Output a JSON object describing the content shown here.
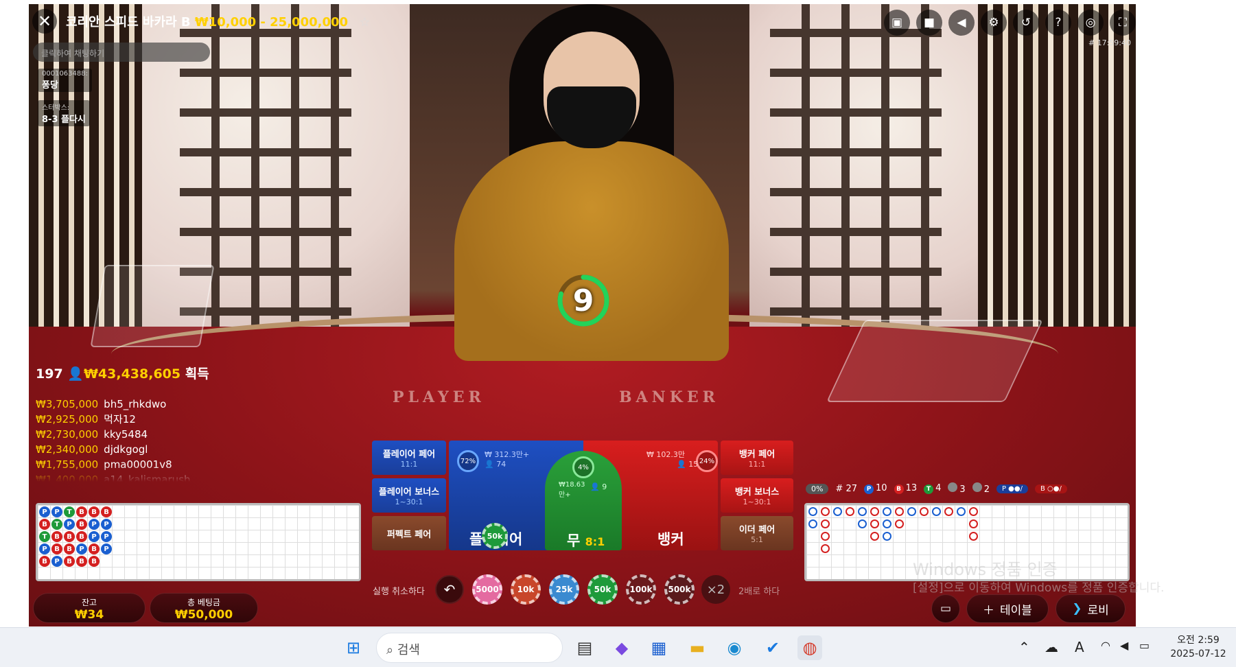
{
  "header": {
    "close_icon": "close-icon",
    "title": "코리안 스피드 바카라 B",
    "limits": "₩10,000 - 25,000,000",
    "favorite_icon": "star-icon"
  },
  "chat_placeholder": "클릭하여 채팅하기",
  "round_info": {
    "id_label": "0001063488:",
    "id_value": "퐁당",
    "streak_label": "스터박스:",
    "streak_value": "8-3 플다시"
  },
  "top_icons": [
    "chat-icon",
    "video-icon",
    "volume-icon",
    "settings-icon",
    "history-icon",
    "help-icon",
    "headset-icon",
    "fullscreen-icon"
  ],
  "game_id": "# 17:59:40",
  "countdown": "9",
  "totals": {
    "players": "197",
    "amount": "₩43,438,605",
    "suffix": "획득"
  },
  "winners": [
    {
      "amount": "₩3,705,000",
      "name": "bh5_rhkdwo"
    },
    {
      "amount": "₩2,925,000",
      "name": "먹자12"
    },
    {
      "amount": "₩2,730,000",
      "name": "kky5484"
    },
    {
      "amount": "₩2,340,000",
      "name": "djdkgogl"
    },
    {
      "amount": "₩1,755,000",
      "name": "pma00001v8"
    },
    {
      "amount": "₩1,400,000",
      "name": "a14_kalismarush"
    }
  ],
  "table_labels": {
    "player": "PLAYER",
    "banker": "BANKER"
  },
  "side_bets": {
    "player_pair": {
      "label": "플레이어 페어",
      "odds": "11:1"
    },
    "player_bonus": {
      "label": "플레이어 보너스",
      "odds": "1~30:1"
    },
    "perfect_pair": {
      "label": "퍼펙트 페어",
      "odds": ""
    },
    "banker_pair": {
      "label": "뱅커 페어",
      "odds": "11:1"
    },
    "banker_bonus": {
      "label": "뱅커 보너스",
      "odds": "1~30:1"
    },
    "either_pair": {
      "label": "이더 페어",
      "odds": "5:1"
    }
  },
  "main_bets": {
    "player": {
      "label": "플레이어",
      "pct": "72%",
      "amount": "₩ 312.3만+",
      "count": "74",
      "chip": "50k"
    },
    "tie": {
      "label": "무",
      "odds": "8:1",
      "pct": "4%",
      "amount": "₩18.63만+",
      "count": "9"
    },
    "banker": {
      "label": "뱅커",
      "pct": "24%",
      "amount": "₩ 102.3만",
      "count": "15"
    }
  },
  "controls": {
    "undo_label": "실행 취소하다",
    "undo_icon": "undo-icon",
    "double_label": "2배로 하다",
    "double_button": "×2"
  },
  "chips": [
    {
      "label": "5000",
      "color": "#e46aa0"
    },
    {
      "label": "10k",
      "color": "#c8462a"
    },
    {
      "label": "25k",
      "color": "#3a8ad0"
    },
    {
      "label": "50k",
      "color": "#1e9a3a"
    },
    {
      "label": "100k",
      "color": "#6a1a1c"
    },
    {
      "label": "500k",
      "color": "#5a1a1c"
    }
  ],
  "balance": {
    "label": "잔고",
    "value": "₩34"
  },
  "total_bet": {
    "label": "총 베팅금",
    "value": "₩50,000"
  },
  "road_stats": {
    "pct": "0%",
    "rounds": "# 27",
    "player": "10",
    "banker": "13",
    "tie": "4",
    "p_pair": "3",
    "b_pair": "2",
    "p_predict": "P",
    "b_predict": "B"
  },
  "bead_road": [
    [
      "P",
      "P",
      "T",
      "B",
      "B",
      "B"
    ],
    [
      "B",
      "T",
      "P",
      "B",
      "P",
      "P"
    ],
    [
      "T",
      "B",
      "B",
      "B",
      "P",
      "P"
    ],
    [
      "P",
      "B",
      "B",
      "P",
      "B",
      "P"
    ],
    [
      "B",
      "P",
      "B",
      "B",
      "B",
      ""
    ]
  ],
  "buttons": {
    "table": "테이블",
    "lobby": "로비",
    "cards_icon": "cards-icon"
  },
  "windows_notice": {
    "title": "Windows 정품 인증",
    "body": "[설정]으로 이동하여 Windows를 정품 인증합니다."
  },
  "taskbar": {
    "search_placeholder": "검색",
    "time": "오전 2:59",
    "date": "2025-07-12"
  }
}
